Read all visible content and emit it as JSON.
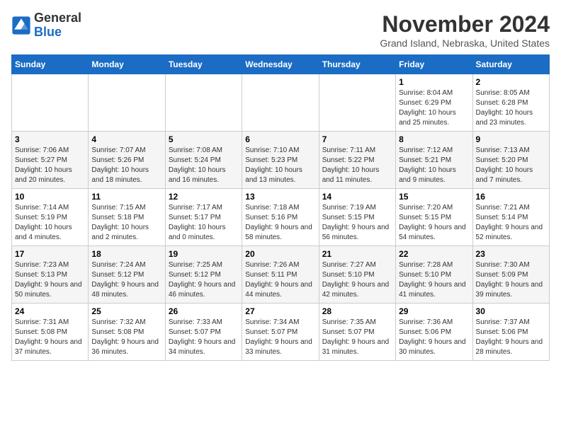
{
  "header": {
    "logo_line1": "General",
    "logo_line2": "Blue",
    "month_title": "November 2024",
    "location": "Grand Island, Nebraska, United States"
  },
  "days_of_week": [
    "Sunday",
    "Monday",
    "Tuesday",
    "Wednesday",
    "Thursday",
    "Friday",
    "Saturday"
  ],
  "weeks": [
    [
      {
        "day": "",
        "info": ""
      },
      {
        "day": "",
        "info": ""
      },
      {
        "day": "",
        "info": ""
      },
      {
        "day": "",
        "info": ""
      },
      {
        "day": "",
        "info": ""
      },
      {
        "day": "1",
        "info": "Sunrise: 8:04 AM\nSunset: 6:29 PM\nDaylight: 10 hours and 25 minutes."
      },
      {
        "day": "2",
        "info": "Sunrise: 8:05 AM\nSunset: 6:28 PM\nDaylight: 10 hours and 23 minutes."
      }
    ],
    [
      {
        "day": "3",
        "info": "Sunrise: 7:06 AM\nSunset: 5:27 PM\nDaylight: 10 hours and 20 minutes."
      },
      {
        "day": "4",
        "info": "Sunrise: 7:07 AM\nSunset: 5:26 PM\nDaylight: 10 hours and 18 minutes."
      },
      {
        "day": "5",
        "info": "Sunrise: 7:08 AM\nSunset: 5:24 PM\nDaylight: 10 hours and 16 minutes."
      },
      {
        "day": "6",
        "info": "Sunrise: 7:10 AM\nSunset: 5:23 PM\nDaylight: 10 hours and 13 minutes."
      },
      {
        "day": "7",
        "info": "Sunrise: 7:11 AM\nSunset: 5:22 PM\nDaylight: 10 hours and 11 minutes."
      },
      {
        "day": "8",
        "info": "Sunrise: 7:12 AM\nSunset: 5:21 PM\nDaylight: 10 hours and 9 minutes."
      },
      {
        "day": "9",
        "info": "Sunrise: 7:13 AM\nSunset: 5:20 PM\nDaylight: 10 hours and 7 minutes."
      }
    ],
    [
      {
        "day": "10",
        "info": "Sunrise: 7:14 AM\nSunset: 5:19 PM\nDaylight: 10 hours and 4 minutes."
      },
      {
        "day": "11",
        "info": "Sunrise: 7:15 AM\nSunset: 5:18 PM\nDaylight: 10 hours and 2 minutes."
      },
      {
        "day": "12",
        "info": "Sunrise: 7:17 AM\nSunset: 5:17 PM\nDaylight: 10 hours and 0 minutes."
      },
      {
        "day": "13",
        "info": "Sunrise: 7:18 AM\nSunset: 5:16 PM\nDaylight: 9 hours and 58 minutes."
      },
      {
        "day": "14",
        "info": "Sunrise: 7:19 AM\nSunset: 5:15 PM\nDaylight: 9 hours and 56 minutes."
      },
      {
        "day": "15",
        "info": "Sunrise: 7:20 AM\nSunset: 5:15 PM\nDaylight: 9 hours and 54 minutes."
      },
      {
        "day": "16",
        "info": "Sunrise: 7:21 AM\nSunset: 5:14 PM\nDaylight: 9 hours and 52 minutes."
      }
    ],
    [
      {
        "day": "17",
        "info": "Sunrise: 7:23 AM\nSunset: 5:13 PM\nDaylight: 9 hours and 50 minutes."
      },
      {
        "day": "18",
        "info": "Sunrise: 7:24 AM\nSunset: 5:12 PM\nDaylight: 9 hours and 48 minutes."
      },
      {
        "day": "19",
        "info": "Sunrise: 7:25 AM\nSunset: 5:12 PM\nDaylight: 9 hours and 46 minutes."
      },
      {
        "day": "20",
        "info": "Sunrise: 7:26 AM\nSunset: 5:11 PM\nDaylight: 9 hours and 44 minutes."
      },
      {
        "day": "21",
        "info": "Sunrise: 7:27 AM\nSunset: 5:10 PM\nDaylight: 9 hours and 42 minutes."
      },
      {
        "day": "22",
        "info": "Sunrise: 7:28 AM\nSunset: 5:10 PM\nDaylight: 9 hours and 41 minutes."
      },
      {
        "day": "23",
        "info": "Sunrise: 7:30 AM\nSunset: 5:09 PM\nDaylight: 9 hours and 39 minutes."
      }
    ],
    [
      {
        "day": "24",
        "info": "Sunrise: 7:31 AM\nSunset: 5:08 PM\nDaylight: 9 hours and 37 minutes."
      },
      {
        "day": "25",
        "info": "Sunrise: 7:32 AM\nSunset: 5:08 PM\nDaylight: 9 hours and 36 minutes."
      },
      {
        "day": "26",
        "info": "Sunrise: 7:33 AM\nSunset: 5:07 PM\nDaylight: 9 hours and 34 minutes."
      },
      {
        "day": "27",
        "info": "Sunrise: 7:34 AM\nSunset: 5:07 PM\nDaylight: 9 hours and 33 minutes."
      },
      {
        "day": "28",
        "info": "Sunrise: 7:35 AM\nSunset: 5:07 PM\nDaylight: 9 hours and 31 minutes."
      },
      {
        "day": "29",
        "info": "Sunrise: 7:36 AM\nSunset: 5:06 PM\nDaylight: 9 hours and 30 minutes."
      },
      {
        "day": "30",
        "info": "Sunrise: 7:37 AM\nSunset: 5:06 PM\nDaylight: 9 hours and 28 minutes."
      }
    ]
  ]
}
